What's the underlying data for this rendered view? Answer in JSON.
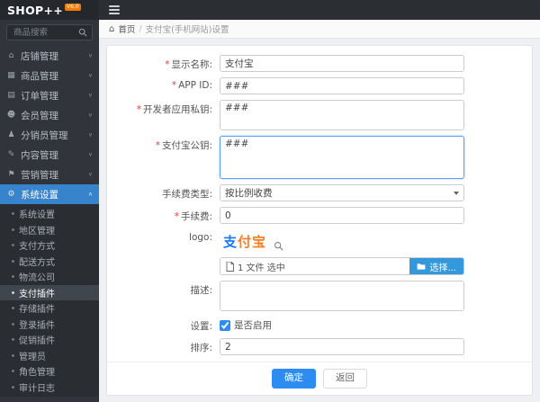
{
  "app": {
    "logo": "SHOP++",
    "logo_badge": "V6.0",
    "search_placeholder": "商品搜索"
  },
  "colors": {
    "accent_blue": "#2d8cf0",
    "sidebar_active_blue": "#3884cc",
    "required_red": "#e4393c",
    "badge_orange": "#f57c00"
  },
  "icons": {
    "home": "⌂",
    "chevron_down": "∨",
    "chevron_up": "∧",
    "menu_shop": "⌂",
    "menu_goods": "▦",
    "menu_orders": "▤",
    "menu_members": "☻",
    "menu_distributors": "♟",
    "menu_content": "✎",
    "menu_marketing": "⚑",
    "menu_system": "⚙",
    "required_mark": "*"
  },
  "sidebar": {
    "menu": [
      {
        "label": "店铺管理"
      },
      {
        "label": "商品管理"
      },
      {
        "label": "订单管理"
      },
      {
        "label": "会员管理"
      },
      {
        "label": "分销员管理"
      },
      {
        "label": "内容管理"
      },
      {
        "label": "营销管理"
      },
      {
        "label": "系统设置"
      }
    ],
    "submenu": [
      "系统设置",
      "地区管理",
      "支付方式",
      "配送方式",
      "物流公司",
      "支付插件",
      "存储插件",
      "登录插件",
      "促销插件",
      "管理员",
      "角色管理",
      "审计日志"
    ],
    "active_menu": "系统设置",
    "active_submenu": "支付插件"
  },
  "breadcrumb": {
    "home": "首页",
    "separator": "/",
    "current": "支付宝(手机网站)设置"
  },
  "form": {
    "display_name": {
      "label": "显示名称:",
      "value": "支付宝"
    },
    "app_id": {
      "label": "APP ID:",
      "value": "###"
    },
    "private_key": {
      "label": "开发者应用私钥:",
      "value": "###"
    },
    "public_key": {
      "label": "支付宝公钥:",
      "value": "###"
    },
    "fee_type": {
      "label": "手续费类型:",
      "value": "按比例收费"
    },
    "fee": {
      "label": "手续费:",
      "value": "0"
    },
    "logo": {
      "label": "logo:",
      "alipay_char": "支",
      "alipay_rest": "付宝",
      "file_status": "1 文件 选中",
      "choose_button": "选择..."
    },
    "description": {
      "label": "描述:",
      "value": ""
    },
    "settings": {
      "label": "设置:",
      "checkbox_label": "是否启用",
      "checked": true
    },
    "order": {
      "label": "排序:",
      "value": "2"
    }
  },
  "footer": {
    "submit": "确定",
    "back": "返回"
  }
}
